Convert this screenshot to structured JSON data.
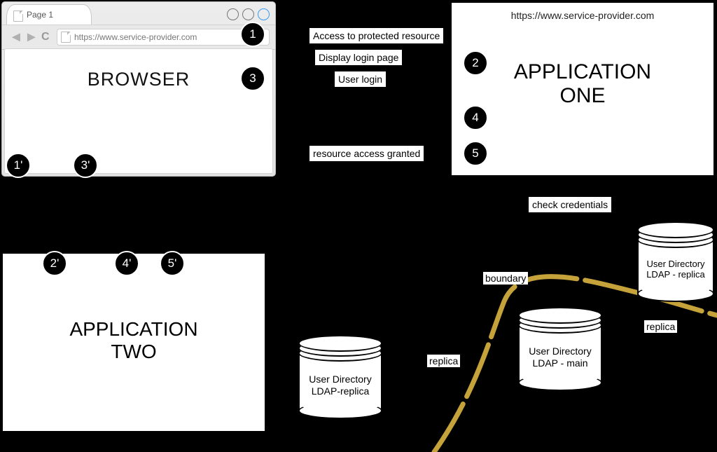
{
  "browser": {
    "tab_title": "Page 1",
    "address": "https://www.service-provider.com",
    "title": "BROWSER"
  },
  "app_one": {
    "url": "https://www.service-provider.com",
    "title_line1": "APPLICATION",
    "title_line2": "ONE"
  },
  "app_two": {
    "title_line1": "APPLICATION",
    "title_line2": "TWO"
  },
  "steps": {
    "s1": "1",
    "s2": "2",
    "s3": "3",
    "s4": "4",
    "s5": "5",
    "s1p": "1'",
    "s2p": "2'",
    "s3p": "3'",
    "s4p": "4'",
    "s5p": "5'",
    "msg_access": "Access to protected resource",
    "msg_display_login": "Display login page",
    "msg_user_login": "User login",
    "msg_granted": "resource access granted",
    "msg_check": "check credentials"
  },
  "directories": {
    "replica_left_line1": "User Directory",
    "replica_left_line2": "LDAP-replica",
    "main_line1": "User Directory",
    "main_line2": "LDAP - main",
    "replica_right_line1": "User Directory",
    "replica_right_line2": "LDAP - replica"
  },
  "labels": {
    "boundary": "boundary",
    "replica": "replica"
  }
}
